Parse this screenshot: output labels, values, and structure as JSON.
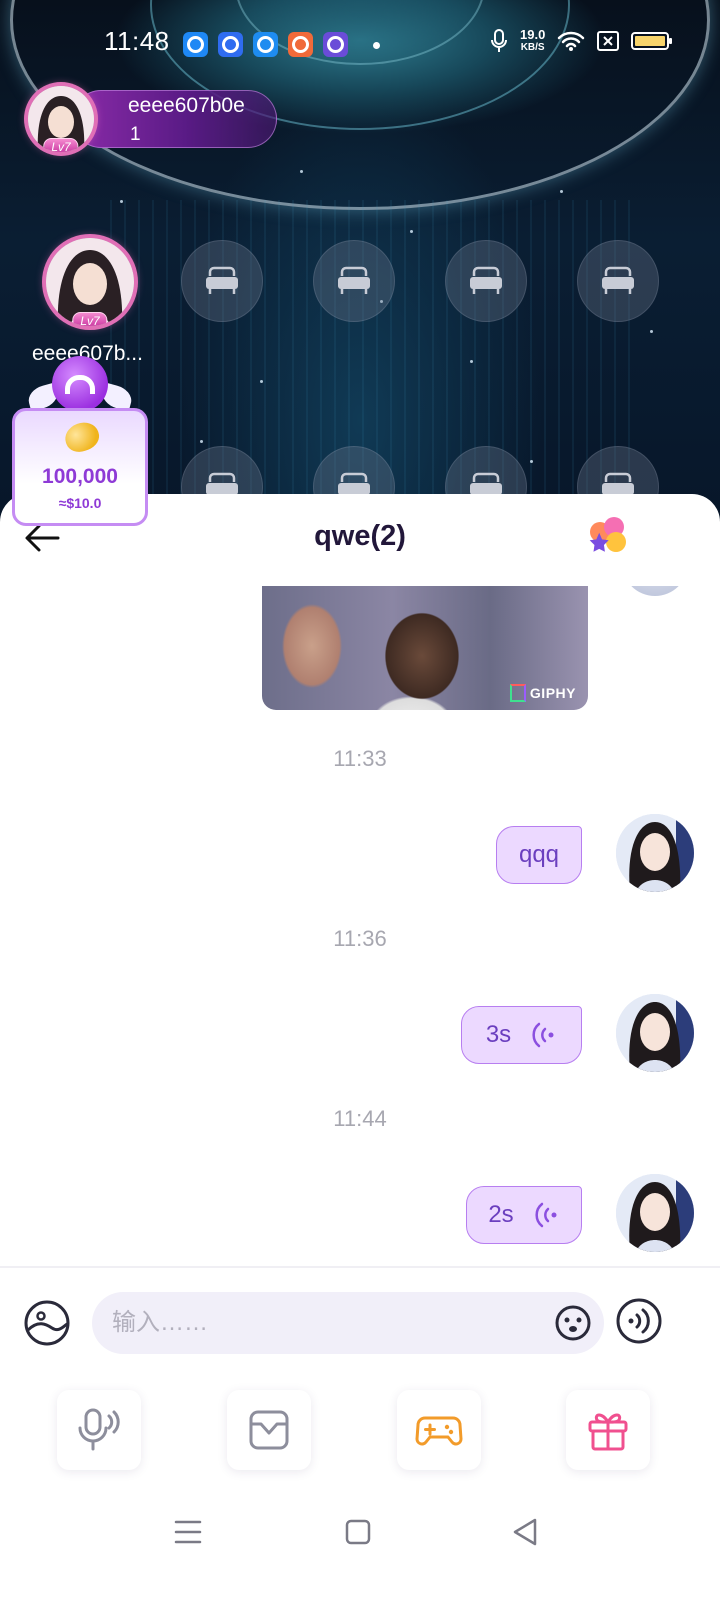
{
  "status_bar": {
    "time": "11:48",
    "notification_icons": [
      {
        "name": "app-notification-icon",
        "color": "#1e88f5"
      },
      {
        "name": "baidu-notification-icon",
        "color": "#2f6cf0"
      },
      {
        "name": "qq-browser-notification-icon",
        "color": "#1e8cf0"
      },
      {
        "name": "game-notification-icon",
        "color": "#f06a3a"
      },
      {
        "name": "app-notification-icon",
        "color": "#6a4cd8"
      }
    ],
    "net_speed_value": "19.0",
    "net_speed_unit": "KB/S"
  },
  "room": {
    "host_name": "eeee607b0e",
    "host_count": "1",
    "host_level": "Lv7",
    "seat_host_name": "eeee607b...",
    "seat_host_level": "Lv7",
    "coins": "100,000",
    "coins_usd": "≈$10.0"
  },
  "chat": {
    "title": "qwe(2)",
    "gif_brand": "GIPHY",
    "messages": [
      {
        "time": "11:33",
        "type": "text",
        "text": "qqq"
      },
      {
        "time": "11:36",
        "type": "voice",
        "text": "3s"
      },
      {
        "time": "11:44",
        "type": "voice",
        "text": "2s"
      }
    ]
  },
  "input": {
    "placeholder": "输入……"
  },
  "colors": {
    "accent": "#9b4ee6",
    "bubble_bg": "#ecd9ff",
    "bubble_border": "#b77ef0",
    "title": "#22173a"
  }
}
